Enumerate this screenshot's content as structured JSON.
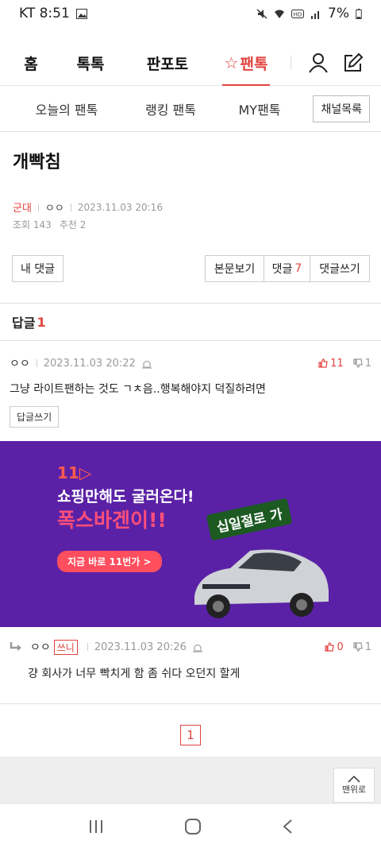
{
  "status": {
    "carrier_time": "KT 8:51",
    "battery": "7%"
  },
  "topnav": {
    "tabs": [
      "홈",
      "톡톡",
      "판포토",
      "팬톡"
    ],
    "active_tab": "팬톡"
  },
  "subnav": {
    "items": [
      "오늘의 팬톡",
      "랭킹 팬톡",
      "MY팬톡"
    ],
    "channel_button": "채널목록"
  },
  "post": {
    "title": "개빡침",
    "category": "군대",
    "author": "ㅇㅇ",
    "date": "2023.11.03 20:16",
    "views": "조회 143",
    "recommends": "추천 2"
  },
  "buttons": {
    "my_comments": "내 댓글",
    "view_post": "본문보기",
    "comments_label": "댓글",
    "comments_count": "7",
    "write_comment": "댓글쓰기"
  },
  "replies": {
    "label": "답글",
    "count": "1"
  },
  "comments": [
    {
      "author": "ㅇㅇ",
      "date": "2023.11.03 20:22",
      "text": "그냥 라이트팬하는 것도 ㄱㅊ음..행복해야지 덕질하려면",
      "up": "11",
      "down": "1",
      "reply_button": "답글쓰기"
    },
    {
      "author": "ㅇㅇ",
      "badge": "쓰니",
      "date": "2023.11.03 20:26",
      "text": "걍 회사가 너무 빡치게 함 좀 쉬다 오던지 할게",
      "up": "0",
      "down": "1"
    }
  ],
  "ad": {
    "logo": "11",
    "line1": "쇼핑만해도 굴러온다!",
    "line2": "폭스바겐이!!",
    "slogan": "십일절로 가",
    "cta": "지금 바로 11번가 >"
  },
  "pagination": {
    "current": "1"
  },
  "top_button": "맨위로",
  "colors": {
    "accent": "#e1433f",
    "ad_bg": "#5a21a6"
  }
}
